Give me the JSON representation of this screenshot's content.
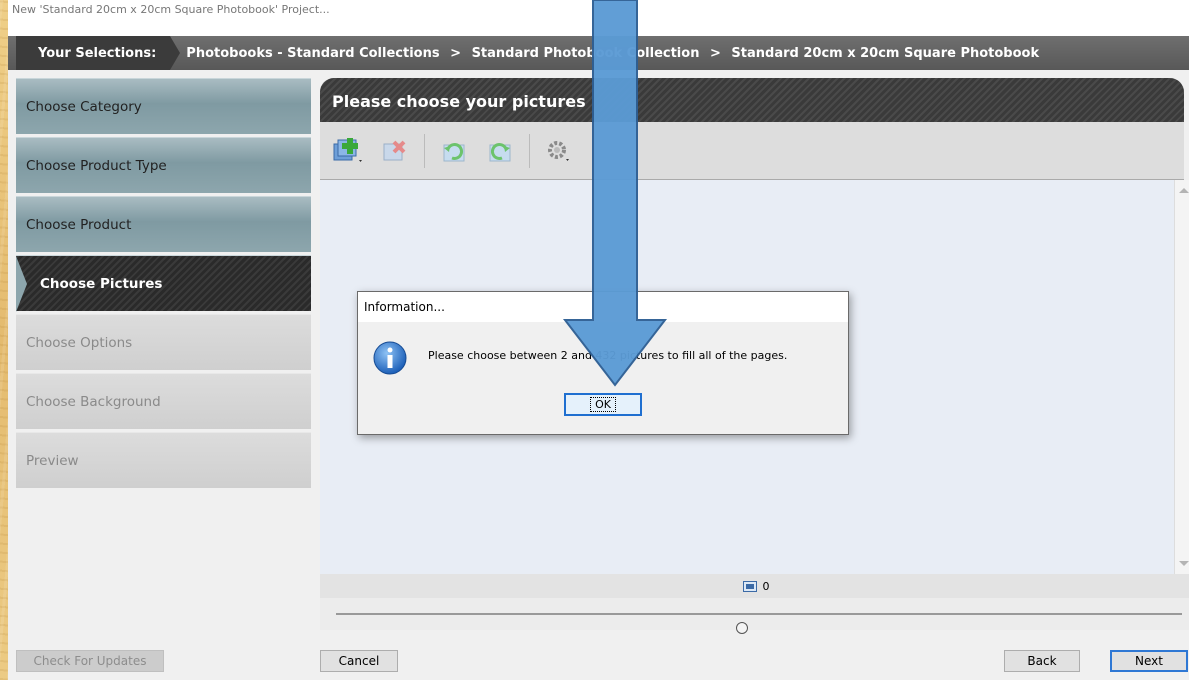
{
  "window": {
    "title": "New 'Standard 20cm x 20cm Square Photobook' Project..."
  },
  "breadcrumb": {
    "label": "Your Selections:",
    "items": [
      "Photobooks - Standard Collections",
      "Standard Photobook Collection",
      "Standard 20cm x 20cm Square Photobook"
    ],
    "separator": ">"
  },
  "sidebar": {
    "items": [
      {
        "label": "Choose Category",
        "state": "done"
      },
      {
        "label": "Choose Product Type",
        "state": "done"
      },
      {
        "label": "Choose Product",
        "state": "done"
      },
      {
        "label": "Choose Pictures",
        "state": "active"
      },
      {
        "label": "Choose Options",
        "state": "disabled"
      },
      {
        "label": "Choose Background",
        "state": "disabled"
      },
      {
        "label": "Preview",
        "state": "disabled"
      }
    ]
  },
  "panel": {
    "title": "Please choose your pictures",
    "toolbar": [
      "add-pictures-icon",
      "remove-picture-icon",
      "rotate-left-icon",
      "rotate-right-icon",
      "settings-icon"
    ],
    "picture_count": "0",
    "zoom_fraction": 0.48
  },
  "footer": {
    "check_updates": "Check For Updates",
    "cancel": "Cancel",
    "back": "Back",
    "next": "Next"
  },
  "dialog": {
    "title": "Information...",
    "message": "Please choose between 2 and 432 pictures to fill all of the pages.",
    "ok": "OK",
    "icon": "info-icon"
  },
  "colors": {
    "arrow": "#5b9bd5",
    "arrow_border": "#2e5f94",
    "active_step": "#2f2f2f",
    "completed_step": "#8da6ad",
    "dialog_ok_border": "#1f6fd0"
  }
}
